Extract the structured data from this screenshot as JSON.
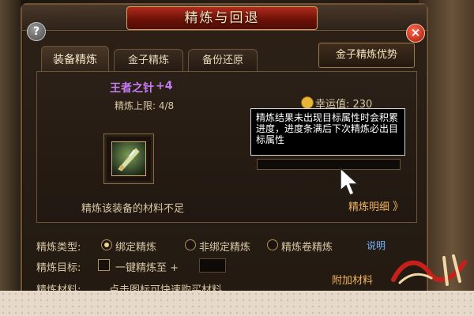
{
  "window": {
    "title": "精炼与回退",
    "help_label": "?",
    "close_label": "×"
  },
  "tabs": [
    {
      "label": "装备精炼",
      "active": true
    },
    {
      "label": "金子精炼",
      "active": false
    },
    {
      "label": "备份还原",
      "active": false
    }
  ],
  "advantage_button": "金子精炼优势",
  "item": {
    "name": "王者之针",
    "level": "+4",
    "refine_limit": "精炼上限: 4/8",
    "icon": "needle-weapon-icon"
  },
  "luck": {
    "text": "幸运值: 230"
  },
  "tooltip": {
    "text": "精炼结果未出现目标属性时会积累进度，进度条满后下次精炼必出目标属性"
  },
  "progress": {
    "fraction": 0.0
  },
  "messages": {
    "insufficient": "精炼该装备的材料不足",
    "detail": "精炼明细",
    "detail_chevron": "》"
  },
  "refine_type": {
    "label": "精炼类型:",
    "options": [
      {
        "label": "绑定精炼",
        "checked": true
      },
      {
        "label": "非绑定精炼",
        "checked": false
      },
      {
        "label": "精炼卷精炼",
        "checked": false
      }
    ],
    "help": "说明"
  },
  "refine_target": {
    "label": "精炼目标:",
    "checkbox_label": "一键精炼至 +",
    "value": ""
  },
  "refine_material": {
    "label": "精炼材料:",
    "hint": "点击图标可快速购买材料",
    "add_label": "附加材料"
  },
  "colors": {
    "accent": "#f0b35f",
    "purple_name": "#c77cf6",
    "title_red": "#b02a1c"
  }
}
